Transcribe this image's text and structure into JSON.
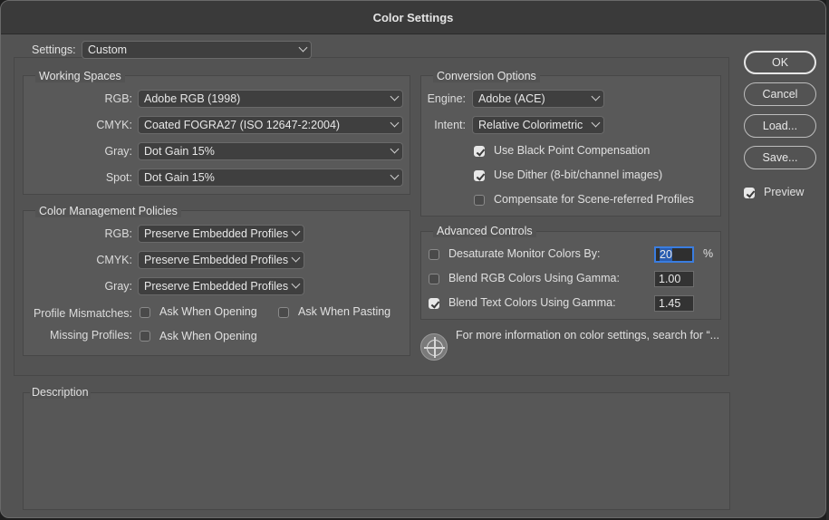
{
  "window": {
    "title": "Color Settings"
  },
  "settings": {
    "label": "Settings:",
    "value": "Custom"
  },
  "working_spaces": {
    "title": "Working Spaces",
    "rgb": {
      "label": "RGB:",
      "value": "Adobe RGB (1998)"
    },
    "cmyk": {
      "label": "CMYK:",
      "value": "Coated FOGRA27 (ISO 12647-2:2004)"
    },
    "gray": {
      "label": "Gray:",
      "value": "Dot Gain 15%"
    },
    "spot": {
      "label": "Spot:",
      "value": "Dot Gain 15%"
    }
  },
  "policies": {
    "title": "Color Management Policies",
    "rgb": {
      "label": "RGB:",
      "value": "Preserve Embedded Profiles"
    },
    "cmyk": {
      "label": "CMYK:",
      "value": "Preserve Embedded Profiles"
    },
    "gray": {
      "label": "Gray:",
      "value": "Preserve Embedded Profiles"
    },
    "mismatches": {
      "label": "Profile Mismatches:",
      "ask_open": "Ask When Opening",
      "ask_paste": "Ask When Pasting"
    },
    "missing": {
      "label": "Missing Profiles:",
      "ask_open": "Ask When Opening"
    }
  },
  "conversion": {
    "title": "Conversion Options",
    "engine": {
      "label": "Engine:",
      "value": "Adobe (ACE)"
    },
    "intent": {
      "label": "Intent:",
      "value": "Relative Colorimetric"
    },
    "black_point": {
      "label": "Use Black Point Compensation",
      "checked": true
    },
    "dither": {
      "label": "Use Dither (8-bit/channel images)",
      "checked": true
    },
    "scene": {
      "label": "Compensate for Scene-referred Profiles",
      "checked": false
    }
  },
  "advanced": {
    "title": "Advanced Controls",
    "desaturate": {
      "label": "Desaturate Monitor Colors By:",
      "value": "20",
      "unit": "%",
      "checked": false
    },
    "blend_rgb": {
      "label": "Blend RGB Colors Using Gamma:",
      "value": "1.00",
      "checked": false
    },
    "blend_text": {
      "label": "Blend Text Colors Using Gamma:",
      "value": "1.45",
      "checked": true
    }
  },
  "info": {
    "text": "For more information on color settings, search for “..."
  },
  "description": {
    "title": "Description"
  },
  "buttons": {
    "ok": "OK",
    "cancel": "Cancel",
    "load": "Load...",
    "save": "Save...",
    "preview": "Preview"
  }
}
